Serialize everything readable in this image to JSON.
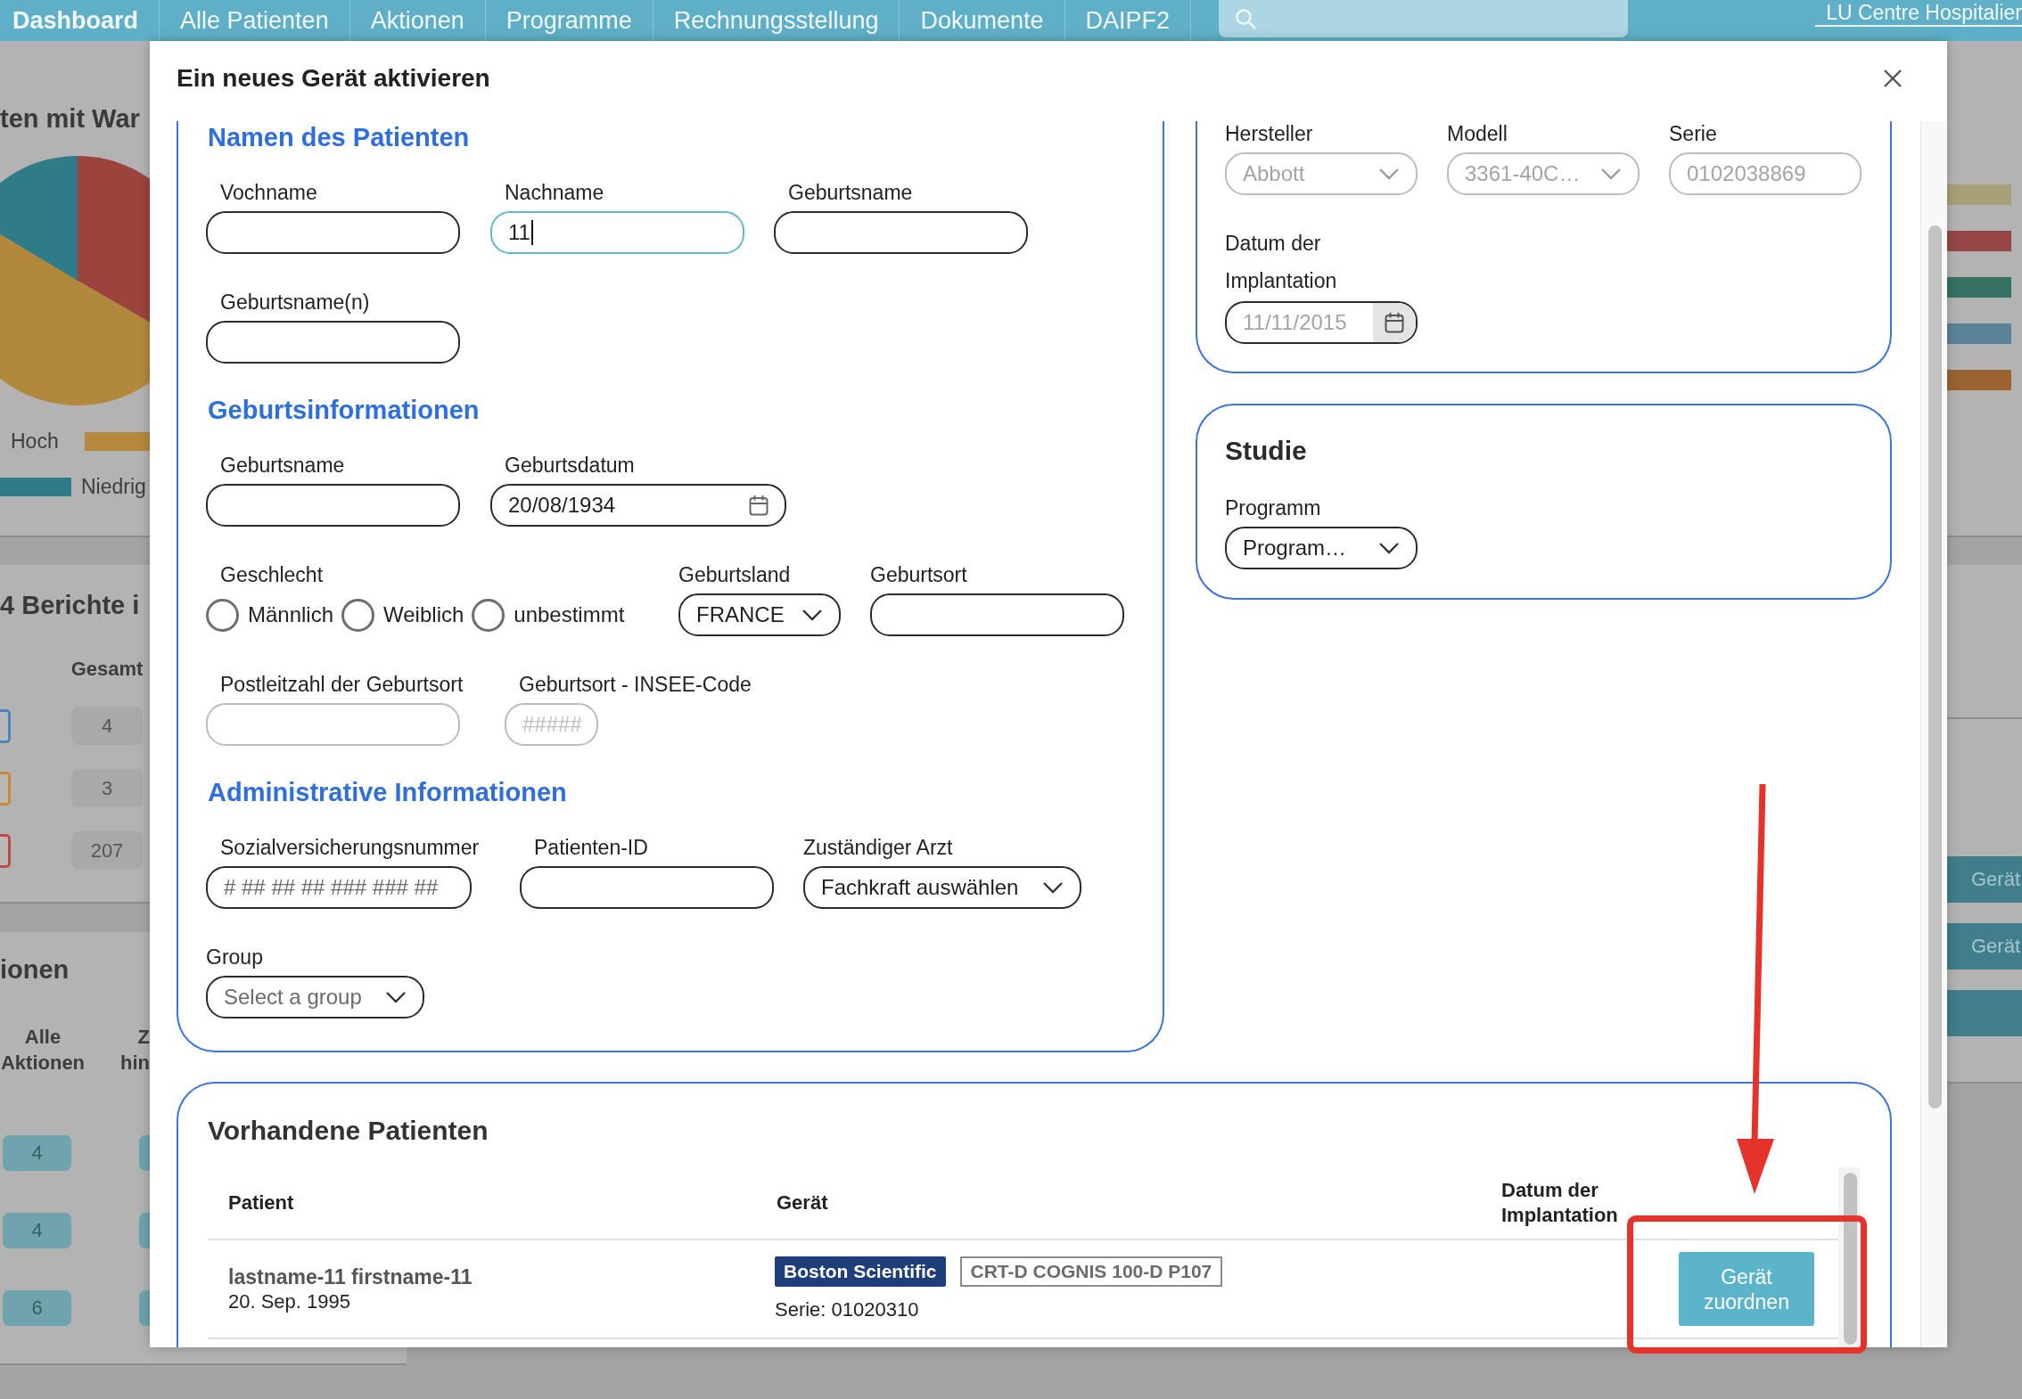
{
  "nav": {
    "items": [
      {
        "label": "Dashboard",
        "selected": true
      },
      {
        "label": "Alle Patienten",
        "selected": false
      },
      {
        "label": "Aktionen",
        "selected": false
      },
      {
        "label": "Programme",
        "selected": false
      },
      {
        "label": "Rechnungsstellung",
        "selected": false
      },
      {
        "label": "Dokumente",
        "selected": false
      },
      {
        "label": "DAIPF2",
        "selected": false
      }
    ],
    "facility": "LU Centre Hospitalier"
  },
  "background": {
    "left": {
      "chart_title": "ten mit War",
      "legend_rows": [
        [
          {
            "kind": "text",
            "text": "Hoch"
          },
          {
            "kind": "swatch",
            "color": "#b5893d"
          }
        ],
        [
          {
            "kind": "swatch",
            "color": "#2f7b88"
          },
          {
            "kind": "text",
            "text": "Niedrig"
          }
        ]
      ],
      "reports": {
        "title": "4 Berichte i",
        "column": "Gesamt",
        "rows": [
          {
            "color": "#4a84b8",
            "count": "4"
          },
          {
            "color": "#cc8a30",
            "count": "3"
          },
          {
            "color": "#c04a42",
            "count": "207"
          }
        ]
      },
      "actions": {
        "title": "ionen",
        "columns": [
          "Alle Aktionen",
          "Z hin"
        ],
        "rows": [
          {
            "count": "4"
          },
          {
            "count": "4"
          },
          {
            "count": "6"
          }
        ]
      }
    },
    "right": {
      "legend_bars": [
        {
          "color": "#a8a07a"
        },
        {
          "color": "#964646"
        },
        {
          "color": "#357264"
        },
        {
          "color": "#5d8399"
        },
        {
          "color": "#9a6332"
        }
      ],
      "buttons": [
        {
          "label": "Gerät"
        },
        {
          "label": "Gerät"
        }
      ]
    }
  },
  "modal": {
    "title": "Ein neues Gerät aktivieren",
    "patient_form": {
      "sections": [
        {
          "title": "Namen des Patienten",
          "rows": [
            [
              {
                "kind": "text",
                "label": "Vochname",
                "focused": false,
                "disabled": false
              },
              {
                "kind": "text",
                "label": "Nachname",
                "value": "11",
                "focused": true,
                "disabled": false
              },
              {
                "kind": "text",
                "label": "Geburtsname",
                "focused": false,
                "disabled": false
              }
            ],
            [
              {
                "kind": "text",
                "label": "Geburtsname(n)",
                "focused": false,
                "disabled": false
              }
            ]
          ]
        },
        {
          "title": "Geburtsinformationen",
          "rows": [
            [
              {
                "kind": "text",
                "label": "Geburtsname",
                "focused": false,
                "disabled": false
              },
              {
                "kind": "date",
                "label": "Geburtsdatum",
                "value": "20/08/1934",
                "focused": false,
                "disabled": false
              }
            ],
            [
              {
                "kind": "radio",
                "label": "Geschlecht",
                "focused": false,
                "disabled": false,
                "options": [
                  {
                    "label": "Männlich",
                    "selected": false
                  },
                  {
                    "label": "Weiblich",
                    "selected": false
                  },
                  {
                    "label": "unbestimmt",
                    "selected": false
                  }
                ]
              },
              {
                "kind": "select",
                "label": "Geburtsland",
                "value": "FRANCE",
                "focused": false,
                "disabled": false
              },
              {
                "kind": "text",
                "label": "Geburtsort",
                "focused": false,
                "disabled": false
              }
            ],
            [
              {
                "kind": "text",
                "label": "Postleitzahl der Geburtsort",
                "focused": false,
                "disabled": true
              },
              {
                "kind": "text",
                "label": "Geburtsort - INSEE-Code",
                "placeholder": "#####",
                "focused": false,
                "disabled": true
              }
            ]
          ]
        },
        {
          "title": "Administrative Informationen",
          "rows": [
            [
              {
                "kind": "text",
                "label": "Sozialversicherungsnummer",
                "placeholder": "# ## ## ## ### ### ##",
                "focused": false,
                "disabled": false
              },
              {
                "kind": "text",
                "label": "Patienten-ID",
                "focused": false,
                "disabled": false
              },
              {
                "kind": "select",
                "label": "Zuständiger Arzt",
                "value": "Fachkraft auswählen",
                "focused": false,
                "disabled": false
              }
            ],
            [
              {
                "kind": "select",
                "label": "Group",
                "placeholder": "Select a group",
                "focused": false,
                "disabled": false
              }
            ]
          ]
        }
      ]
    },
    "device": {
      "fields": [
        {
          "kind": "select",
          "label": "Hersteller",
          "value": "Abbott",
          "disabled": true
        },
        {
          "kind": "select",
          "label": "Modell",
          "value": "3361-40C…",
          "disabled": true
        },
        {
          "kind": "text",
          "label": "Serie",
          "value": "0102038869",
          "disabled": true
        }
      ],
      "implant_date": {
        "label": "Datum der Implantation",
        "value": "11/11/2015",
        "disabled": true
      }
    },
    "study": {
      "title": "Studie",
      "field": {
        "kind": "select",
        "label": "Programm",
        "value": "Program…",
        "disabled": false
      }
    },
    "existing_patients": {
      "title": "Vorhandene Patienten",
      "columns": [
        "Patient",
        "Gerät",
        "Datum der Implantation"
      ],
      "rows": [
        {
          "name": "lastname-11 firstname-11",
          "birth_date": "20. Sep. 1995",
          "manufacturer": "Boston Scientific",
          "model": "CRT-D COGNIS 100-D P107",
          "serial": "Serie: 01020310",
          "action": "Gerät zuordnen"
        }
      ]
    }
  }
}
